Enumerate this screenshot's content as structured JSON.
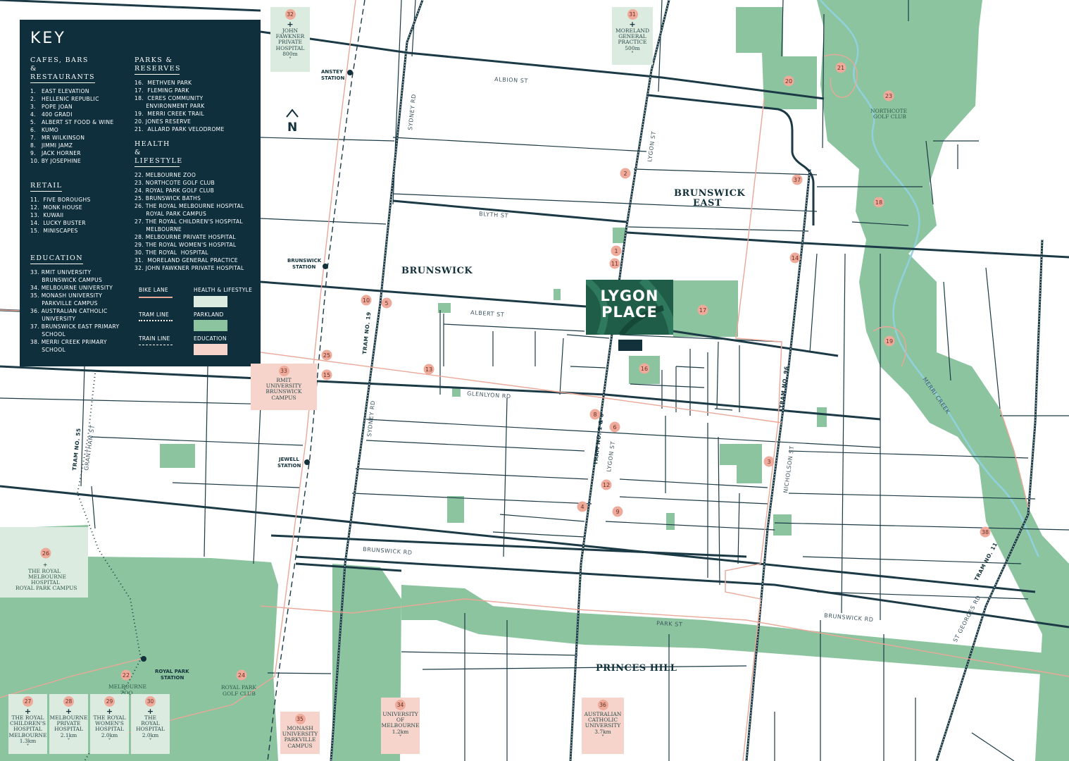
{
  "key": {
    "title": "KEY",
    "cafes": {
      "heading": "CAFES, BARS & RESTAURANTS",
      "items": [
        "1.   EAST ELEVATION",
        "2.   HELLENIC REPUBLIC",
        "3.   POPE JOAN",
        "4.   400 GRADI",
        "5.   ALBERT ST FOOD & WINE",
        "6.   KUMO",
        "7.   MR WILKINSON",
        "8.   JIMMI JAMZ",
        "9.   JACK HORNER",
        "10. BY JOSEPHINE"
      ]
    },
    "retail": {
      "heading": "RETAIL",
      "items": [
        "11.  FIVE BOROUGHS",
        "12.  MONK HOUSE",
        "13.  KUWAII",
        "14.  LUCKY BUSTER",
        "15.  MINISCAPES"
      ]
    },
    "education": {
      "heading": "EDUCATION",
      "items": [
        "33. RMIT UNIVERSITY",
        "      BRUNSWICK CAMPUS",
        "34. MELBOURNE UNIVERSITY",
        "35. MONASH UNIVERSITY",
        "      PARKVILLE CAMPUS",
        "36. AUSTRALIAN CATHOLIC",
        "      UNIVERSITY",
        "37. BRUNSWICK EAST PRIMARY",
        "      SCHOOL",
        "38. MERRI CREEK PRIMARY",
        "      SCHOOL"
      ]
    },
    "parks": {
      "heading": "PARKS & RESERVES",
      "items": [
        "16.  METHVEN PARK",
        "17.  FLEMING PARK",
        "18.  CERES COMMUNITY",
        "      ENVIRONMENT PARK",
        "19.  MERRI CREEK TRAIL",
        "20. JONES RESERVE",
        "21.  ALLARD PARK VELODROME"
      ]
    },
    "health": {
      "heading": "HEALTH & LIFESTYLE",
      "items": [
        "22. MELBOURNE ZOO",
        "23. NORTHCOTE GOLF CLUB",
        "24. ROYAL PARK GOLF CLUB",
        "25. BRUNSWICK BATHS",
        "26. THE ROYAL MELBOURNE HOSPITAL",
        "      ROYAL PARK CAMPUS",
        "27. THE ROYAL CHILDREN'S HOSPITAL",
        "      MELBOURNE",
        "28. MELBOURNE PRIVATE HOSPITAL",
        "29. THE ROYAL WOMEN'S HOSPITAL",
        "30. THE ROYAL  HOSPITAL",
        "31.  MORELAND GENERAL PRACTICE",
        "32. JOHN FAWKNER PRIVATE HOSPITAL"
      ]
    },
    "legend": {
      "bike_lane": "BIKE LANE",
      "tram_line": "TRAM LINE",
      "train_line": "TRAIN LINE",
      "health_lifestyle": "HEALTH & LIFESTYLE",
      "parkland": "PARKLAND",
      "education": "EDUCATION"
    }
  },
  "colors": {
    "navy": "#0f2f3d",
    "park": "#8cc49f",
    "park_dark": "#6aaa82",
    "bike": "#eaa898",
    "poi": "#eeaa9a",
    "health_bg": "#dcebe0",
    "edu_bg": "#f6d4cb",
    "creek": "#8fd1dc"
  },
  "compass": "N",
  "development": "LYGON PLACE",
  "suburbs": {
    "brunswick": "BRUNSWICK",
    "brunswick_east_1": "BRUNSWICK",
    "brunswick_east_2": "EAST",
    "princes_hill": "PRINCES HILL"
  },
  "roads": {
    "albion": "ALBION ST",
    "blyth": "BLYTH ST",
    "albert": "ALBERT ST",
    "glenlyon": "GLENLYON RD",
    "brunswick_rd": "BRUNSWICK RD",
    "brunswick_rd_e": "BRUNSWICK RD",
    "park": "PARK ST",
    "sydney_n": "SYDNEY RD",
    "sydney_s": "SYDNEY RD",
    "lygon_n": "LYGON ST",
    "lygon_s": "LYGON ST",
    "nicholson": "NICHOLSON ST",
    "grantham": "GRANTHAM ST",
    "st_georges": "ST GEORGES RD",
    "merri_creek": "MERRI CREEK"
  },
  "trams": {
    "t19": "TRAM NO. 19",
    "t1_8": "TRAM NO. 1 & 8",
    "t96": "TRAM NO. 96",
    "t55": "TRAM NO. 55",
    "t11": "TRAM NO. 11"
  },
  "stations": {
    "anstey": [
      "ANSTEY",
      "STATION"
    ],
    "brunswick": [
      "BRUNSWICK",
      "STATION"
    ],
    "jewell": [
      "JEWELL",
      "STATION"
    ],
    "royal_park": [
      "ROYAL PARK",
      "STATION"
    ]
  },
  "pois": [
    "1",
    "2",
    "3",
    "4",
    "5",
    "6",
    "8",
    "9",
    "10",
    "11",
    "12",
    "13",
    "14",
    "15",
    "16",
    "17",
    "18",
    "19",
    "20",
    "21",
    "22",
    "23",
    "24",
    "25",
    "26",
    "37",
    "38"
  ],
  "poi_labels": {
    "northcote_golf": [
      "NORTHCOTE",
      "GOLF CLUB"
    ],
    "melbourne_zoo": [
      "MELBOURNE",
      "ZOO"
    ],
    "royal_park_golf": [
      "ROYAL PARK",
      "GOLF CLUB"
    ],
    "rmh": [
      "THE ROYAL",
      "MELBOURNE",
      "HOSPITAL",
      "ROYAL PARK CAMPUS"
    ]
  },
  "callouts": {
    "c32": {
      "num": "32",
      "lines": [
        "JOHN",
        "FAWKNER",
        "PRIVATE",
        "HOSPITAL",
        "800m"
      ]
    },
    "c31": {
      "num": "31",
      "lines": [
        "MORELAND",
        "GENERAL",
        "PRACTICE",
        "500m"
      ]
    },
    "c33": {
      "num": "33",
      "lines": [
        "RMIT",
        "UNIVERSITY",
        "BRUNSWICK",
        "CAMPUS"
      ]
    },
    "c27": {
      "num": "27",
      "lines": [
        "THE ROYAL",
        "CHILDREN'S",
        "HOSPITAL",
        "MELBOURNE",
        "1.3km"
      ]
    },
    "c28": {
      "num": "28",
      "lines": [
        "MELBOURNE",
        "PRIVATE",
        "HOSPITAL",
        "2.1km"
      ]
    },
    "c29": {
      "num": "29",
      "lines": [
        "THE ROYAL",
        "WOMEN'S",
        "HOSPITAL",
        "2.0km"
      ]
    },
    "c30": {
      "num": "30",
      "lines": [
        "THE",
        "ROYAL",
        "HOSPITAL",
        "2.0km"
      ]
    },
    "c35": {
      "num": "35",
      "lines": [
        "MONASH",
        "UNIVERSITY",
        "PARKVILLE",
        "CAMPUS"
      ]
    },
    "c34": {
      "num": "34",
      "lines": [
        "UNIVERSITY",
        "OF",
        "MELBOURNE",
        "1.2km"
      ]
    },
    "c36": {
      "num": "36",
      "lines": [
        "AUSTRALIAN",
        "CATHOLIC",
        "UNIVERSITY",
        "3.7km"
      ]
    }
  }
}
